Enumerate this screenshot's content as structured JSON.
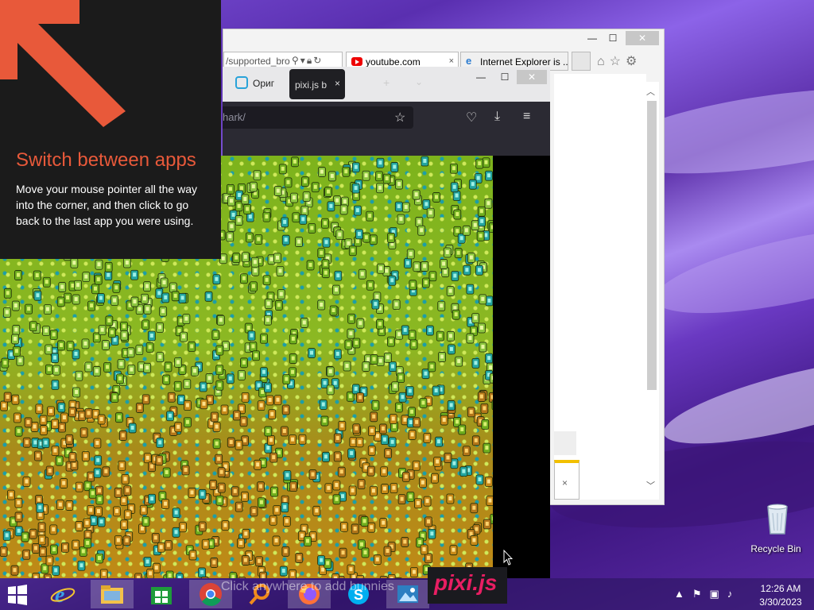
{
  "charm_tip": {
    "title": "Switch between apps",
    "body": "Move your mouse pointer all the way into the corner, and then click to go back to the last app you were using."
  },
  "ie": {
    "url_fragment": "/supported_bro",
    "tabs": [
      {
        "label": "youtube.com",
        "icon": "youtube-icon"
      },
      {
        "label": "Internet Explorer is ...",
        "icon": "ie-icon"
      }
    ],
    "tab_close": "×",
    "notification_close": "×"
  },
  "firefox": {
    "tabs": [
      {
        "label": "Ориг",
        "icon": "robot-icon"
      },
      {
        "label": "pixi.js b",
        "active": true
      }
    ],
    "tab_close": "×",
    "url_fragment": "hark/",
    "new_tab": "+",
    "tab_list": "⌄"
  },
  "pixi_logo_text": "pixi.js",
  "taskbar": {
    "hint": "Click anywhere to add bunnies",
    "apps": [
      "internet-explorer",
      "file-explorer",
      "store",
      "chrome",
      "search-tool",
      "firefox",
      "skype",
      "photos"
    ]
  },
  "recycle_bin": {
    "label": "Recycle Bin"
  },
  "clock": {
    "time": "12:26 AM",
    "date": "3/30/2023"
  },
  "colors": {
    "charm_accent": "#e8593a",
    "pixi_brand": "#e91e63",
    "wallpaper": "#6a39c2"
  }
}
